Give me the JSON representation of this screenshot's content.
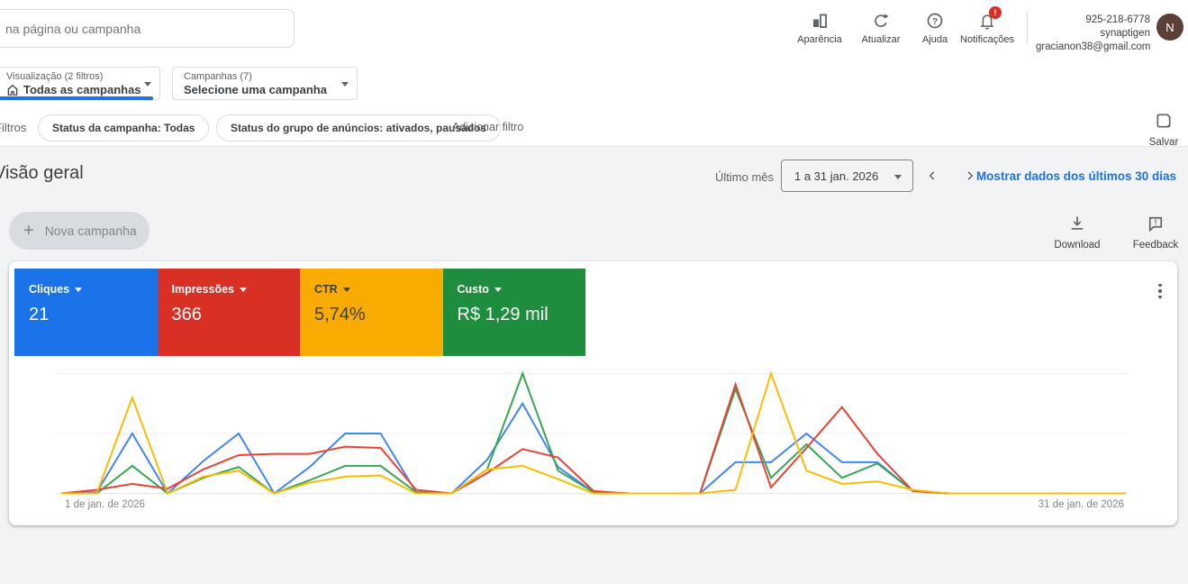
{
  "topbar": {
    "search": {
      "placeholder": "na página ou campanha"
    },
    "actions": [
      {
        "icon": "appearance-chart-icon",
        "label": "Aparência"
      },
      {
        "icon": "refresh-icon",
        "label": "Atualizar"
      },
      {
        "icon": "help-icon",
        "label": "Ajuda"
      },
      {
        "icon": "notifications-bell-icon",
        "label": "Notificações",
        "badge": "!"
      }
    ],
    "account": {
      "id_line": "925-218-6778 synaptigen",
      "email": "gracianon38@gmail.com",
      "avatar_initial": "N"
    }
  },
  "scope_bar": {
    "view_selector": {
      "icon": "home-icon",
      "label": "Visualização (2 filtros)",
      "value": "Todas as campanhas",
      "accent_color": "#1a73e8"
    },
    "campaign_selector": {
      "label": "Campanhas (7)",
      "value": "Selecione uma campanha"
    }
  },
  "filter_bar": {
    "title": "Filtros",
    "pills": [
      {
        "label": "Status da campanha: Todas"
      },
      {
        "label": "Status do grupo de anúncios: ativados, pausados"
      }
    ],
    "add_filter_label": "Adicionar filtro",
    "save_label": "Salvar"
  },
  "overview": {
    "title": "Visão geral",
    "date_preset_label": "Último mês",
    "date_range_value": "1 a 31 jan. 2026",
    "show_data_link": "Mostrar dados dos últimos 30 dias",
    "new_campaign_label": "Nova campanha",
    "download_label": "Download",
    "feedback_label": "Feedback"
  },
  "metrics": [
    {
      "label": "Cliques",
      "value": "21",
      "color": "#1a73e8",
      "text_color": "#ffffff"
    },
    {
      "label": "Impressões",
      "value": "366",
      "color": "#d93025",
      "text_color": "#ffffff"
    },
    {
      "label": "CTR",
      "value": "5,74%",
      "color": "#f9ab00",
      "text_color": "#3c4043"
    },
    {
      "label": "Custo",
      "value": "R$ 1,29 mil",
      "color": "#1e8e3e",
      "text_color": "#ffffff"
    }
  ],
  "chart_data": {
    "type": "line",
    "x_axis": {
      "start_label": "1 de jan. de 2026",
      "end_label": "31 de jan. de 2026",
      "days": 31
    },
    "y_axis": {
      "range": [
        0,
        100
      ],
      "gridlines": [
        0,
        50,
        100
      ],
      "note": "y-axis unlabeled in UI; values estimated as percent of plot height, each metric normalized to its own scale"
    },
    "legend_position": "none (line colors match metric cards)",
    "series": [
      {
        "name": "Cliques",
        "color": "#4285f4",
        "z": 1,
        "values": [
          0,
          1,
          50,
          0,
          27,
          50,
          0,
          22,
          50,
          50,
          1,
          0,
          28,
          75,
          22,
          1,
          0,
          0,
          0,
          26,
          26,
          50,
          26,
          26,
          2,
          0,
          0,
          0,
          0,
          0,
          0
        ]
      },
      {
        "name": "Impressões",
        "color": "#ea4335",
        "z": 3,
        "values": [
          0,
          3,
          8,
          4,
          20,
          32,
          33,
          33,
          39,
          38,
          3,
          0,
          17,
          37,
          30,
          2,
          0,
          0,
          0,
          91,
          5,
          38,
          72,
          33,
          2,
          0,
          0,
          0,
          0,
          0,
          0
        ]
      },
      {
        "name": "CTR",
        "color": "#fbbc04",
        "z": 4,
        "values": [
          0,
          0,
          80,
          0,
          14,
          19,
          0,
          9,
          14,
          15,
          0,
          0,
          20,
          23,
          12,
          0,
          0,
          0,
          0,
          3,
          100,
          19,
          8,
          10,
          3,
          0,
          0,
          0,
          0,
          0,
          0
        ]
      },
      {
        "name": "Custo",
        "color": "#34a853",
        "z": 2,
        "values": [
          0,
          0,
          23,
          0,
          13,
          22,
          0,
          11,
          23,
          23,
          1,
          0,
          20,
          100,
          19,
          1,
          0,
          0,
          0,
          87,
          13,
          41,
          13,
          25,
          2,
          0,
          0,
          0,
          0,
          0,
          0
        ]
      }
    ]
  }
}
